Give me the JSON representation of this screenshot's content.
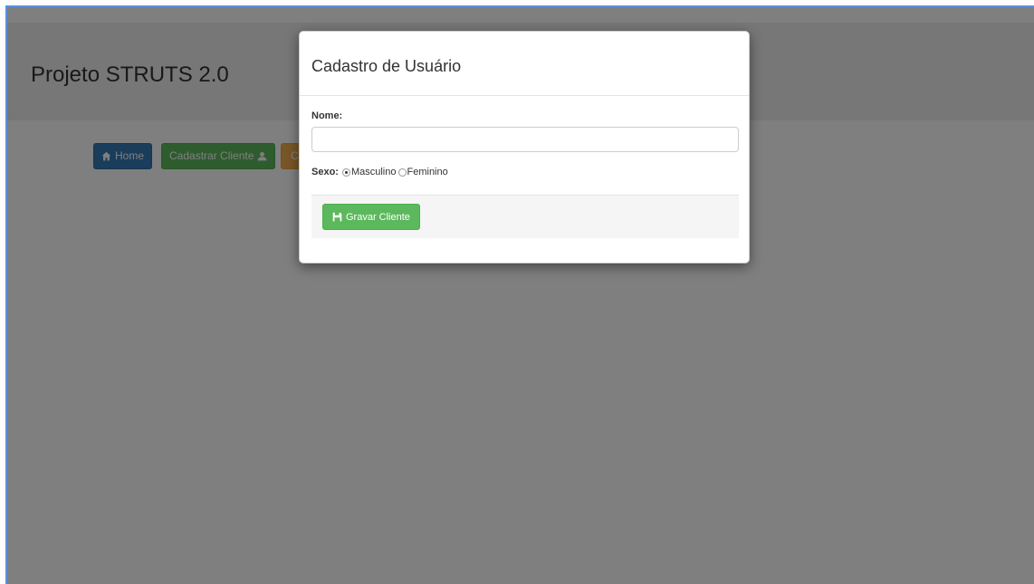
{
  "page": {
    "title": "Projeto STRUTS 2.0"
  },
  "nav": {
    "home_label": "Home",
    "cadastrar_label": "Cadastrar Cliente",
    "third_label": "C"
  },
  "modal": {
    "title": "Cadastro de Usuário",
    "nome_label": "Nome:",
    "nome_value": "",
    "nome_placeholder": "",
    "sexo_label": "Sexo:",
    "sexo_options": [
      "Masculino",
      "Feminino"
    ],
    "sexo_selected": "Masculino",
    "submit_label": "Gravar Cliente"
  },
  "icons": {
    "home": "home-icon",
    "user": "user-icon",
    "save": "floppy-disk-icon"
  },
  "colors": {
    "primary": "#337ab7",
    "success": "#5cb85c",
    "warning": "#f0ad4e",
    "frame_border": "#5b8fd6"
  }
}
